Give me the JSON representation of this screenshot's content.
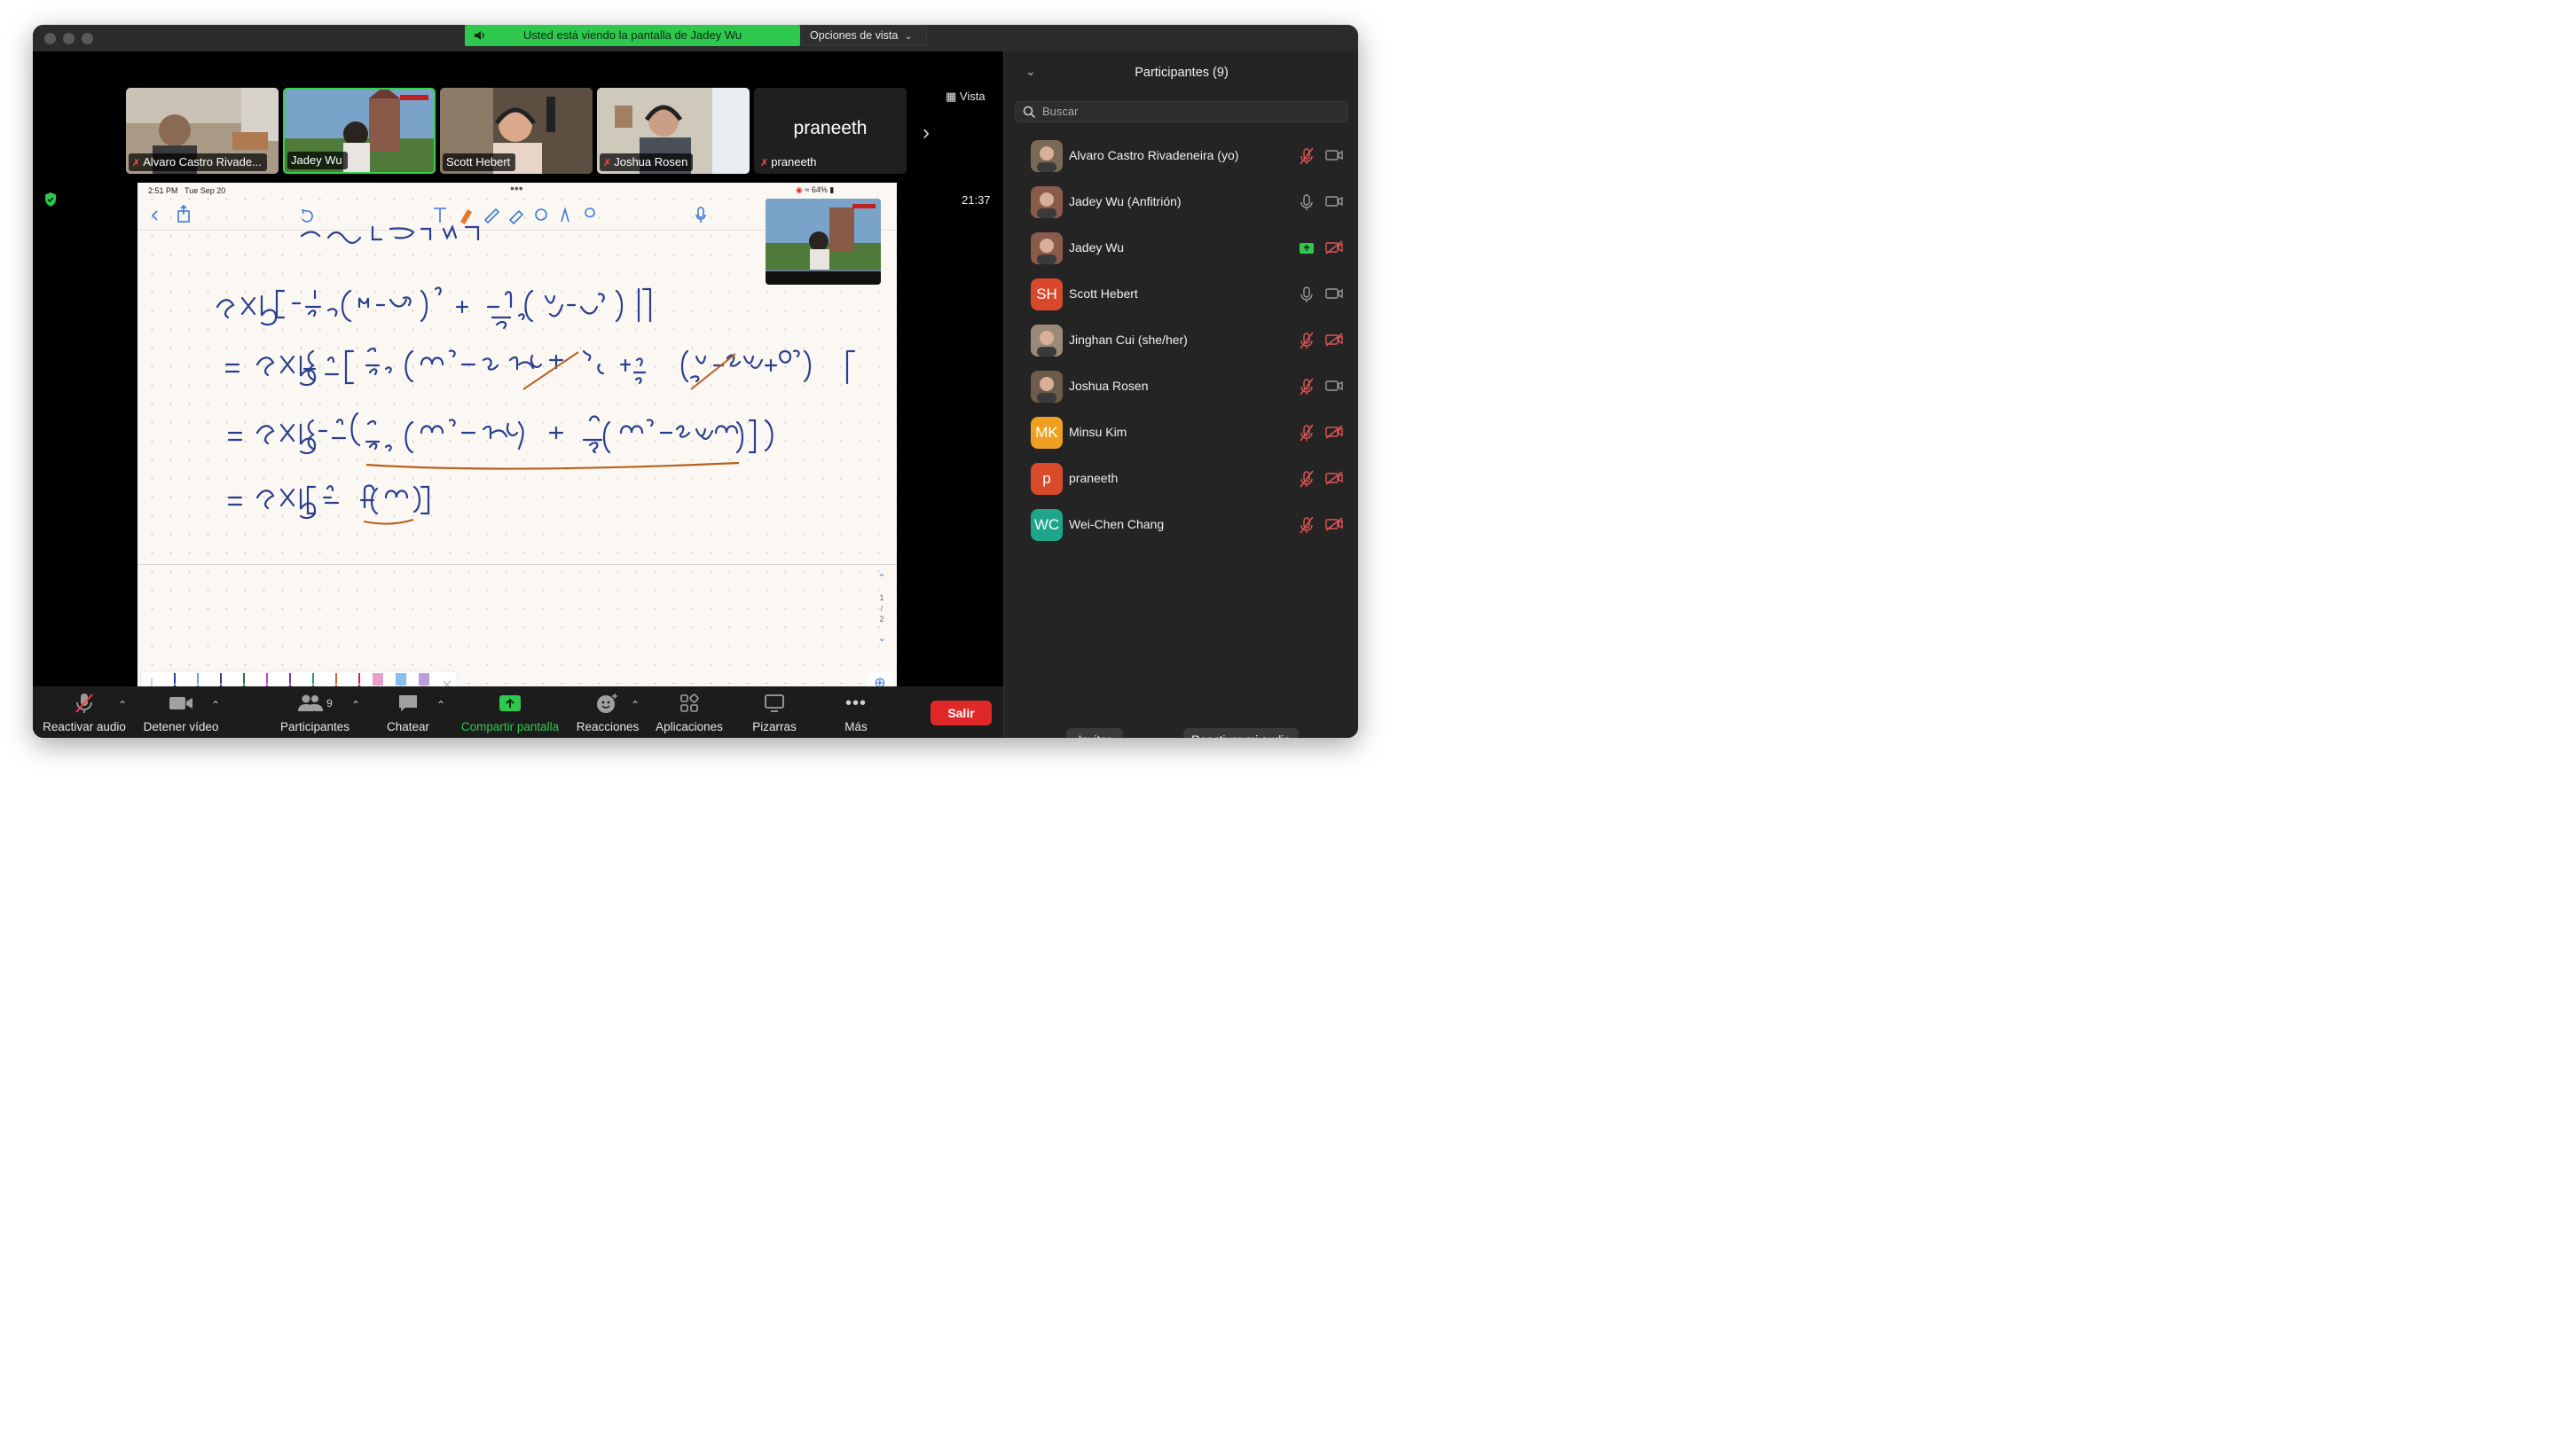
{
  "banner": {
    "text": "Usted está viendo la pantalla de Jadey Wu",
    "view_options": "Opciones de vista"
  },
  "top": {
    "vista": "Vista",
    "timer": "21:37"
  },
  "thumbnails": [
    {
      "name": "Alvaro Castro Rivade...",
      "muted": true
    },
    {
      "name": "Jadey Wu",
      "muted": false
    },
    {
      "name": "Scott Hebert",
      "muted": false
    },
    {
      "name": "Joshua Rosen",
      "muted": true
    },
    {
      "name": "praneeth",
      "muted": true,
      "big_name": "praneeth"
    }
  ],
  "ipad": {
    "time": "2:51 PM",
    "date": "Tue Sep 20",
    "battery": "64%",
    "page_indicator": [
      "1",
      "2"
    ]
  },
  "controls": {
    "audio": "Reactivar audio",
    "video": "Detener vídeo",
    "participants": "Participantes",
    "participants_count": "9",
    "chat": "Chatear",
    "share": "Compartir pantalla",
    "reactions": "Reacciones",
    "apps": "Aplicaciones",
    "whiteboards": "Pizarras",
    "more": "Más",
    "leave": "Salir"
  },
  "panel": {
    "title": "Participantes (9)",
    "search_placeholder": "Buscar",
    "participants": [
      {
        "name": "Alvaro Castro Rivadeneira (yo)",
        "initials": "",
        "color": "#7a6a55",
        "mic": "muted",
        "cam": "on"
      },
      {
        "name": "Jadey Wu (Anfitrión)",
        "initials": "",
        "color": "#8a5a4a",
        "mic": "on",
        "cam": "on"
      },
      {
        "name": "Jadey Wu",
        "initials": "",
        "color": "#8a5a4a",
        "mic": "sharing",
        "cam": "off"
      },
      {
        "name": "Scott Hebert",
        "initials": "SH",
        "color": "#d9482b",
        "mic": "on",
        "cam": "on"
      },
      {
        "name": "Jinghan Cui (she/her)",
        "initials": "",
        "color": "#9c8a78",
        "mic": "muted",
        "cam": "off"
      },
      {
        "name": "Joshua Rosen",
        "initials": "",
        "color": "#6d5b4c",
        "mic": "muted",
        "cam": "on"
      },
      {
        "name": "Minsu Kim",
        "initials": "MK",
        "color": "#f0a020",
        "mic": "muted",
        "cam": "off"
      },
      {
        "name": "praneeth",
        "initials": "p",
        "color": "#d94a2b",
        "mic": "muted",
        "cam": "off"
      },
      {
        "name": "Wei-Chen Chang",
        "initials": "WC",
        "color": "#1fa58a",
        "mic": "muted",
        "cam": "off"
      }
    ],
    "invite": "Invitar",
    "unmute_me": "Reactivar mi audio"
  },
  "colors": {
    "accent_green": "#2ec84e",
    "leave_red": "#e02828",
    "muted_red": "#ff4d4d",
    "ink": "#2b3f8f",
    "underline": "#b8601c"
  }
}
